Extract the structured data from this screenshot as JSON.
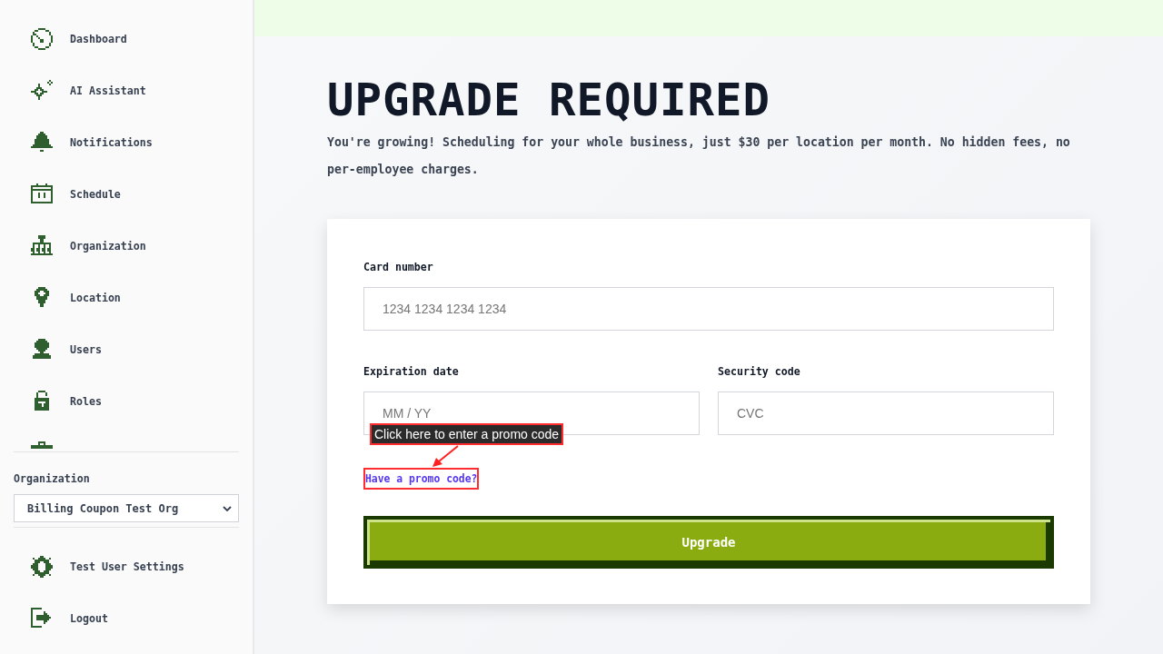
{
  "sidebar": {
    "nav_items": [
      {
        "label": "Dashboard"
      },
      {
        "label": "AI Assistant"
      },
      {
        "label": "Notifications"
      },
      {
        "label": "Schedule"
      },
      {
        "label": "Organization"
      },
      {
        "label": "Location"
      },
      {
        "label": "Users"
      },
      {
        "label": "Roles"
      }
    ],
    "organization": {
      "label": "Organization",
      "value": "Billing Coupon Test Org"
    },
    "footer_items": [
      {
        "label": "Test User Settings"
      },
      {
        "label": "Logout"
      }
    ]
  },
  "page": {
    "title": "UPGRADE REQUIRED",
    "subtitle": "You're growing! Scheduling for your whole business, just $30 per location per month. No hidden fees, no per-employee charges."
  },
  "payment_form": {
    "field_rows": [
      {
        "fields": [
          {
            "label": "Card number",
            "placeholder": "1234 1234 1234 1234"
          }
        ]
      },
      {
        "fields": [
          {
            "label": "Expiration date",
            "placeholder": "MM / YY"
          },
          {
            "label": "Security code",
            "placeholder": "CVC"
          }
        ]
      }
    ],
    "annotation": {
      "text": "Click here to enter a promo code"
    },
    "promo_link": {
      "text": "Have a promo code?",
      "highlighted": true
    },
    "submit_button": "Upgrade"
  }
}
